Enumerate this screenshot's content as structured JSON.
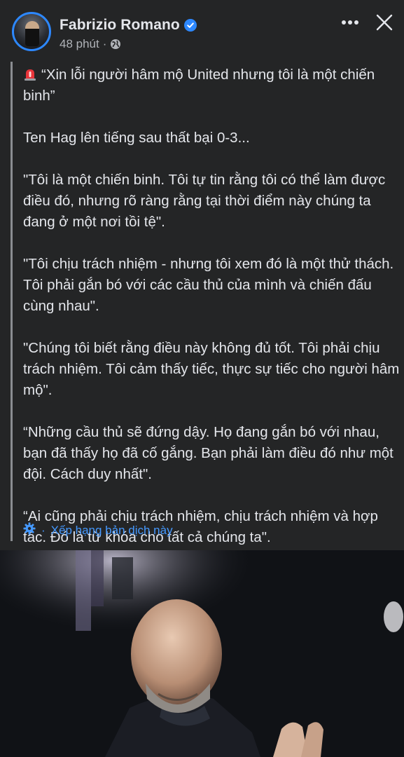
{
  "header": {
    "author_name": "Fabrizio Romano",
    "time": "48 phút",
    "meta_separator": "·",
    "verified_icon": "verified-badge-icon",
    "privacy_icon": "globe-icon",
    "more_icon": "more-horizontal-icon",
    "close_icon": "close-icon"
  },
  "post": {
    "paragraphs": [
      "“Xin lỗi người hâm mộ United nhưng tôi là một chiến binh”",
      "Ten Hag lên tiếng sau thất bại 0-3...",
      "\"Tôi là một chiến binh. Tôi tự tin rằng tôi có thể làm được điều đó, nhưng rõ ràng rằng tại thời điểm này chúng ta đang ở một nơi tồi tệ\".",
      "\"Tôi chịu trách nhiệm - nhưng tôi xem đó là một thử thách. Tôi phải gắn bó với các cầu thủ của mình và chiến đấu cùng nhau\".",
      "\"Chúng tôi biết rằng điều này không đủ tốt. Tôi phải chịu trách nhiệm. Tôi cảm thấy tiếc, thực sự tiếc cho người hâm mộ\".",
      "“Những cầu thủ sẽ đứng dậy. Họ đang gắn bó với nhau, bạn đã thấy họ đã cố gắng. Bạn phải làm điều đó như một đội. Cách duy nhất\".",
      "“Ai cũng phải chịu trách nhiệm, chịu trách nhiệm và hợp tác. Đó là từ khóa cho tất cả chúng ta\"."
    ],
    "leading_icon": "siren-icon",
    "translation": {
      "separator": "·",
      "label": "Xếp hạng bản dịch này",
      "icon": "gear-icon"
    }
  },
  "photo": {
    "icon": "photo-subject"
  },
  "colors": {
    "background": "#242526",
    "text": "#e4e6eb",
    "muted": "#b0b3b8",
    "link": "#4599ff",
    "verified": "#2d88ff",
    "quote_bar": "#8a8d91"
  }
}
